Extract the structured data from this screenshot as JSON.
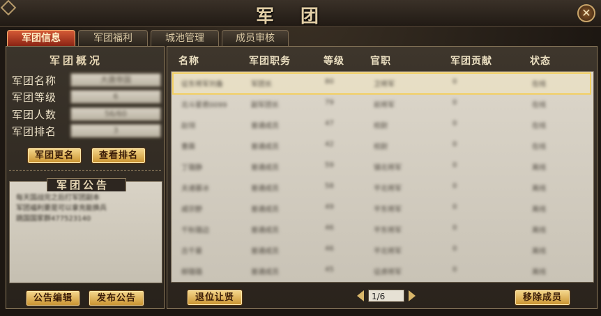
{
  "window": {
    "title": "军团",
    "close_icon": "close-icon"
  },
  "tabs": [
    {
      "label": "军团信息",
      "active": true
    },
    {
      "label": "军团福利",
      "active": false
    },
    {
      "label": "城池管理",
      "active": false
    },
    {
      "label": "成员审核",
      "active": false
    }
  ],
  "overview": {
    "title": "军团概况",
    "fields": [
      {
        "label": "军团名称",
        "value": "大唐帝国"
      },
      {
        "label": "军团等级",
        "value": "6"
      },
      {
        "label": "军团人数",
        "value": "56/60"
      },
      {
        "label": "军团排名",
        "value": "3"
      }
    ],
    "rename_button": "军团更名",
    "ranking_button": "查看排名"
  },
  "notice": {
    "title": "军团公告",
    "text": "每天国战完之后打军团副本\n军团福利要是可以拿充能换兵\n跳国国家群477523140",
    "edit_button": "公告编辑",
    "publish_button": "发布公告"
  },
  "members": {
    "headers": [
      "名称",
      "军团职务",
      "等级",
      "官职",
      "军团贡献",
      "状态"
    ],
    "rows": [
      [
        "征东将军刘备",
        "军团长",
        "80",
        "卫将军",
        "0",
        "在线"
      ],
      [
        "北斗星君0099",
        "副军团长",
        "79",
        "前将军",
        "0",
        "在线"
      ],
      [
        "赵翎",
        "普通成员",
        "47",
        "校尉",
        "0",
        "在线"
      ],
      [
        "曹霖",
        "普通成员",
        "42",
        "校尉",
        "0",
        "在线"
      ],
      [
        "丁璐静",
        "普通成员",
        "59",
        "镇北将军",
        "0",
        "离线"
      ],
      [
        "夫诸慕冰",
        "普通成员",
        "58",
        "平北将军",
        "0",
        "离线"
      ],
      [
        "戚宗野",
        "普通成员",
        "49",
        "平东将军",
        "0",
        "离线"
      ],
      [
        "千秋璐边",
        "普通成员",
        "46",
        "平东将军",
        "0",
        "离线"
      ],
      [
        "古千曼",
        "普通成员",
        "46",
        "平北将军",
        "0",
        "离线"
      ],
      [
        "柳璐璐",
        "普通成员",
        "45",
        "征虏将军",
        "0",
        "离线"
      ]
    ],
    "resign_button": "退位让贤",
    "remove_button": "移除成员",
    "page": "1/6"
  },
  "colors": {
    "accent": "#c9922f",
    "active_tab": "#b23a20",
    "selected_row": "#f2cf63"
  }
}
